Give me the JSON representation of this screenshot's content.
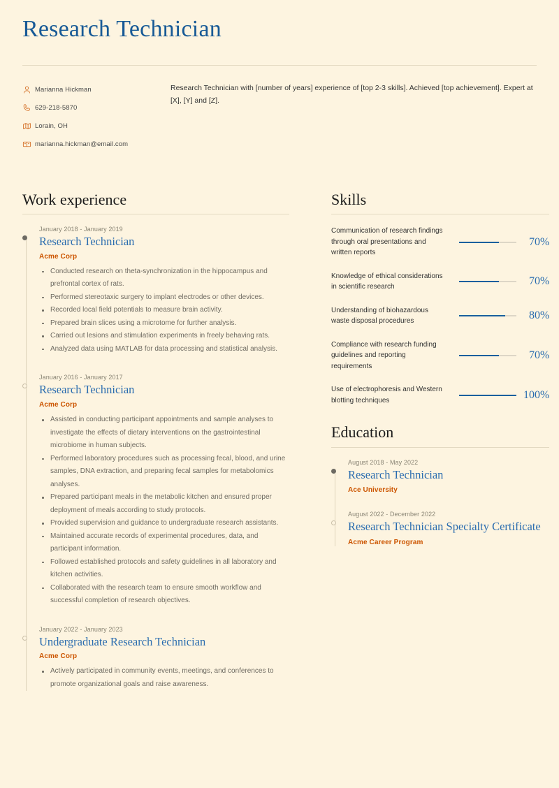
{
  "document": {
    "title": "Research Technician"
  },
  "contact": {
    "items": [
      {
        "icon": "person-icon",
        "text": "Marianna Hickman"
      },
      {
        "icon": "phone-icon",
        "text": "629-218-5870"
      },
      {
        "icon": "location-icon",
        "text": "Lorain, OH"
      },
      {
        "icon": "email-icon",
        "text": "marianna.hickman@email.com"
      }
    ]
  },
  "summary": {
    "text": "Research Technician with [number of years] experience of [top 2-3 skills]. Achieved [top achievement]. Expert at [X], [Y] and [Z]."
  },
  "work_experience": {
    "heading": "Work experience",
    "entries": [
      {
        "date": "January 2018 - January 2019",
        "title": "Research Technician",
        "organization": "Acme Corp",
        "marker": "filled",
        "points": [
          "Conducted research on theta-synchronization in the hippocampus and prefrontal cortex of rats.",
          "Performed stereotaxic surgery to implant electrodes or other devices.",
          "Recorded local field potentials to measure brain activity.",
          "Prepared brain slices using a microtome for further analysis.",
          "Carried out lesions and stimulation experiments in freely behaving rats.",
          "Analyzed data using MATLAB for data processing and statistical analysis."
        ]
      },
      {
        "date": "January 2016 - January 2017",
        "title": "Research Technician",
        "organization": "Acme Corp",
        "marker": "hollow",
        "points": [
          "Assisted in conducting participant appointments and sample analyses to investigate the effects of dietary interventions on the gastrointestinal microbiome in human subjects.",
          "Performed laboratory procedures such as processing fecal, blood, and urine samples, DNA extraction, and preparing fecal samples for metabolomics analyses.",
          "Prepared participant meals in the metabolic kitchen and ensured proper deployment of meals according to study protocols.",
          "Provided supervision and guidance to undergraduate research assistants.",
          "Maintained accurate records of experimental procedures, data, and participant information.",
          "Followed established protocols and safety guidelines in all laboratory and kitchen activities.",
          "Collaborated with the research team to ensure smooth workflow and successful completion of research objectives."
        ]
      },
      {
        "date": "January 2022 - January 2023",
        "title": "Undergraduate Research Technician",
        "organization": "Acme Corp",
        "marker": "hollow",
        "points": [
          "Actively participated in community events, meetings, and conferences to promote organizational goals and raise awareness."
        ]
      }
    ]
  },
  "skills": {
    "heading": "Skills",
    "items": [
      {
        "name": "Communication of research findings through oral presentations and written reports",
        "percent_label": "70%",
        "percent": 70
      },
      {
        "name": "Knowledge of ethical considerations in scientific research",
        "percent_label": "70%",
        "percent": 70
      },
      {
        "name": "Understanding of biohazardous waste disposal procedures",
        "percent_label": "80%",
        "percent": 80
      },
      {
        "name": "Compliance with research funding guidelines and reporting requirements",
        "percent_label": "70%",
        "percent": 70
      },
      {
        "name": "Use of electrophoresis and Western blotting techniques",
        "percent_label": "100%",
        "percent": 100
      }
    ]
  },
  "education": {
    "heading": "Education",
    "entries": [
      {
        "date": "August 2018 - May 2022",
        "title": "Research Technician",
        "organization": "Ace University",
        "marker": "filled"
      },
      {
        "date": "August 2022 - December 2022",
        "title": "Research Technician Specialty Certificate",
        "organization": "Acme Career Program",
        "marker": "hollow"
      }
    ]
  },
  "colors": {
    "background": "#fdf4e0",
    "title_blue": "#185a96",
    "entry_blue": "#2a6caf",
    "accent_orange": "#cc5500",
    "rule": "#e3d9c2",
    "body_text": "#6f6b62"
  }
}
